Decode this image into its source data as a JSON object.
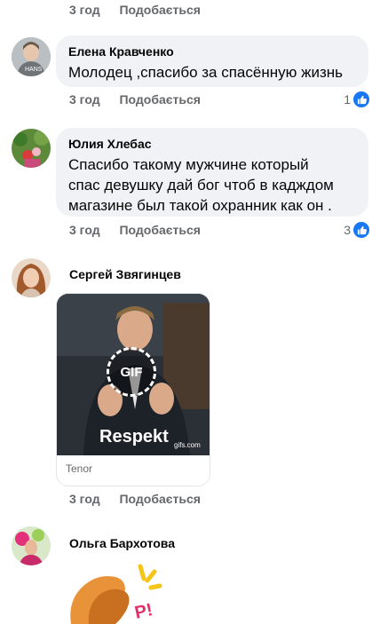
{
  "top_actions": {
    "time": "3 год",
    "like": "Подобається"
  },
  "comments": [
    {
      "author": "Елена Кравченко",
      "text": "Молодец ,спасибо за спасённую жизнь",
      "time": "3 год",
      "like": "Подобається",
      "reactions": "1"
    },
    {
      "author": "Юлия Хлебас",
      "text_lines": [
        "Спасибо такому мужчине который",
        "спас девушку  дай бог чтоб в кадждом",
        "магазине был такой охранник как он ."
      ],
      "time": "3 год",
      "like": "Подобається",
      "reactions": "3"
    },
    {
      "author": "Сергей Звягинцев",
      "gif": {
        "badge": "GIF",
        "caption": "Respekt",
        "watermark": "gifs.com",
        "source": "Tenor"
      },
      "time": "3 год",
      "like": "Подобається"
    },
    {
      "author": "Ольга Бархотова",
      "sticker_text": "P!"
    }
  ],
  "colors": {
    "bubble": "#f0f2f5",
    "meta": "#65676b",
    "like_badge": "#1877f2"
  },
  "icons": [
    "like-thumb-icon"
  ]
}
